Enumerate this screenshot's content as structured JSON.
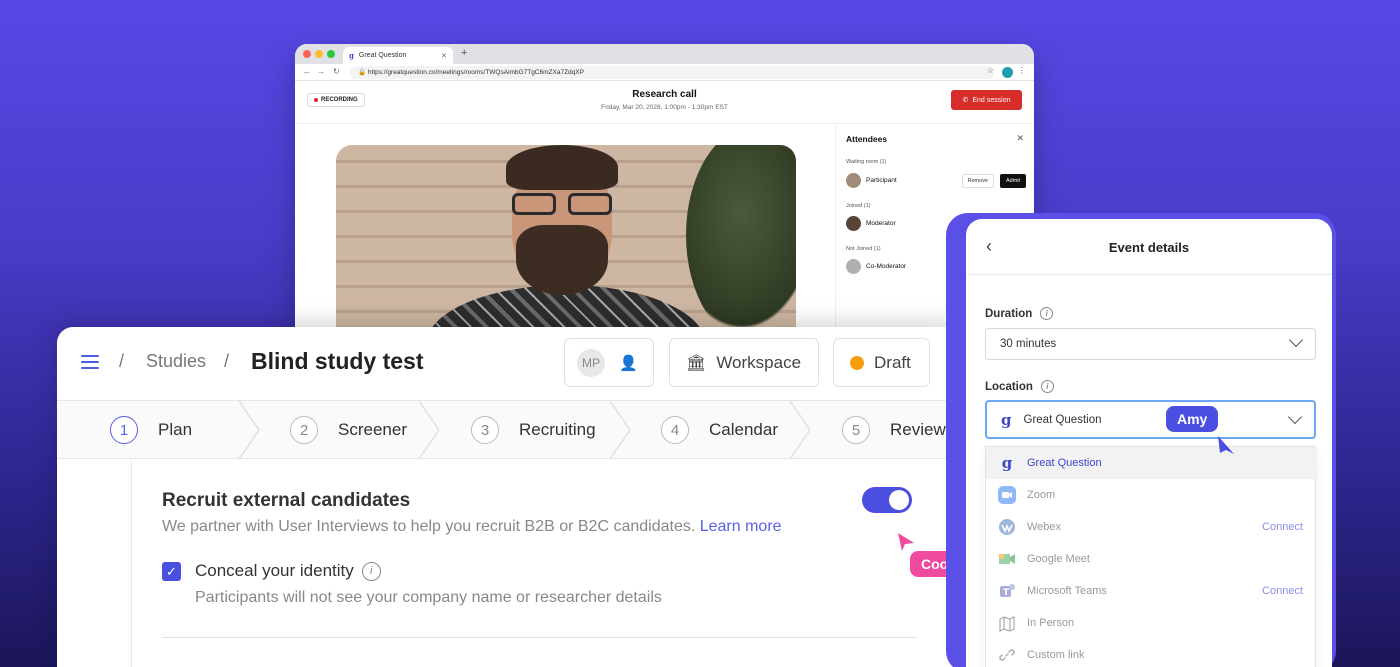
{
  "browser": {
    "tab_title": "Great Question",
    "url": "https://greatquestion.co/meetings/rooms/TWQsAimbG7TgC6mZXa7ZdqXP",
    "recording_label": "RECORDING",
    "call_title": "Research call",
    "call_subtitle": "Friday, Mar 20, 2028, 1:00pm - 1:30pm EST",
    "end_session_label": "End session",
    "attendees": {
      "title": "Attendees",
      "waiting_section": "Waiting room (1)",
      "waiting_person": "Participant",
      "remove_label": "Remove",
      "admit_label": "Admit",
      "joined_section": "Joined (1)",
      "joined_person": "Moderator",
      "not_joined_section": "Not Joined (1)",
      "not_joined_person": "Co-Moderator"
    }
  },
  "study": {
    "breadcrumb_root": "Studies",
    "title": "Blind study test",
    "avatar_initials": "MP",
    "workspace_label": "Workspace",
    "status_label": "Draft",
    "steps": [
      {
        "num": "1",
        "label": "Plan"
      },
      {
        "num": "2",
        "label": "Screener"
      },
      {
        "num": "3",
        "label": "Recruiting"
      },
      {
        "num": "4",
        "label": "Calendar"
      },
      {
        "num": "5",
        "label": "Review"
      }
    ],
    "recruit_title": "Recruit external candidates",
    "recruit_desc": "We partner with User Interviews to help you recruit B2B or B2C candidates.",
    "learn_more": "Learn more",
    "toggle_on": true,
    "conceal_label": "Conceal your identity",
    "conceal_sub": "Participants will not see your company name or researcher details"
  },
  "cursors": {
    "cooper": "Cooper",
    "amy": "Amy",
    "cooper_color": "#ef4a9e",
    "amy_color": "#4b4fe0"
  },
  "event": {
    "title": "Event details",
    "duration_label": "Duration",
    "duration_value": "30 minutes",
    "location_label": "Location",
    "location_value": "Great Question",
    "options": [
      {
        "label": "Great Question",
        "icon": "great-question-icon",
        "action": ""
      },
      {
        "label": "Zoom",
        "icon": "zoom-icon",
        "action": ""
      },
      {
        "label": "Webex",
        "icon": "webex-icon",
        "action": "Connect"
      },
      {
        "label": "Google Meet",
        "icon": "google-meet-icon",
        "action": ""
      },
      {
        "label": "Microsoft Teams",
        "icon": "microsoft-teams-icon",
        "action": "Connect"
      },
      {
        "label": "In Person",
        "icon": "map-icon",
        "action": ""
      },
      {
        "label": "Custom link",
        "icon": "link-icon",
        "action": ""
      }
    ]
  },
  "colors": {
    "accent": "#4b4fe0",
    "record_red": "#d92d2a",
    "draft_orange": "#f59e0b"
  }
}
